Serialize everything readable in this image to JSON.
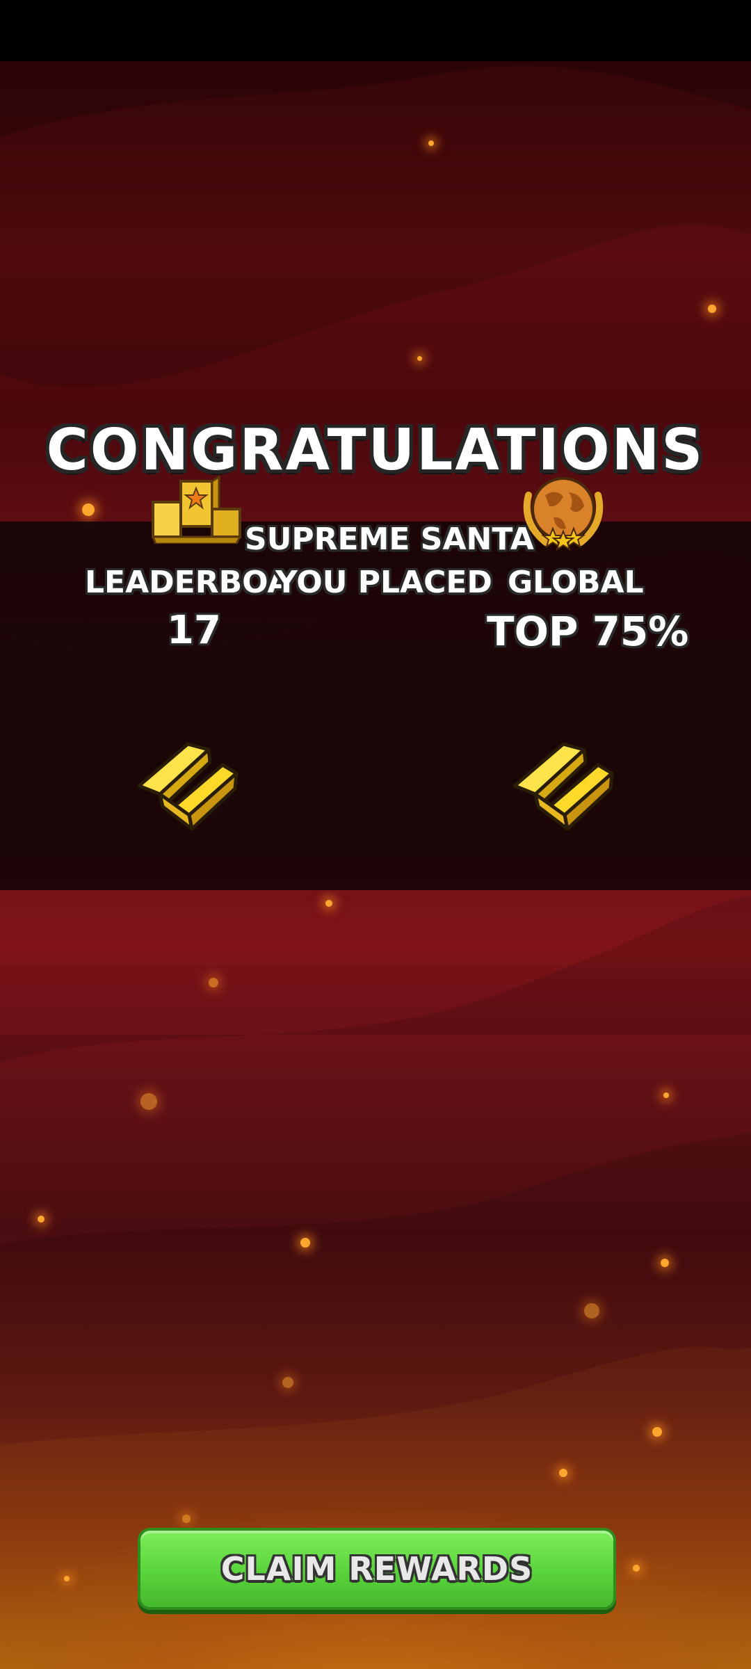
{
  "screen": {
    "title": "CONGRATULATIONS",
    "event_name": "SUPREME SANTA",
    "you_placed_label": "YOU PLACED"
  },
  "leaderboard": {
    "label": "LEADERBOARD",
    "value": "17",
    "icon": "podium-icon"
  },
  "global": {
    "label": "GLOBAL",
    "value": "TOP 75%",
    "icon": "globe-laurel-icon"
  },
  "rewards": [
    {
      "icon": "gold-bars-icon"
    },
    {
      "icon": "gold-bars-icon"
    }
  ],
  "claim_button": {
    "label": "CLAIM REWARDS"
  },
  "colors": {
    "background_top": "#5a0c10",
    "background_bottom": "#c0700e",
    "button_green": "#5ad43c",
    "gold": "#f5c518"
  }
}
